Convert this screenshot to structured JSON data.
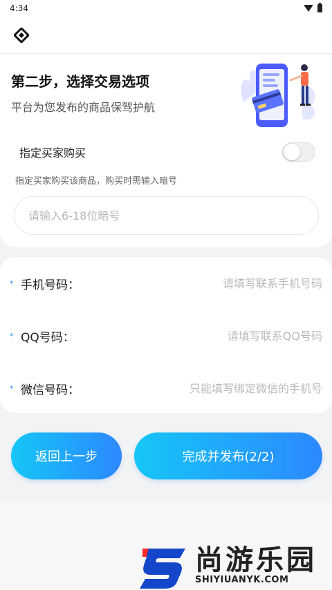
{
  "status": {
    "time": "4:34"
  },
  "colors": {
    "accent": "#2c88ff",
    "accent_light": "#15c6f7",
    "star": "#2e8bff"
  },
  "header": {
    "title": "第二步，选择交易选项",
    "subtitle": "平台为您发布的商品保驾护航"
  },
  "designated_buyer": {
    "label": "指定买家购买",
    "enabled": false,
    "hint": "指定买家购买该商品，购买时需输入暗号",
    "code_placeholder": "请输入6-18位暗号"
  },
  "contact": {
    "phone": {
      "star": "*",
      "label": "手机号码：",
      "placeholder": "请填写联系手机号码"
    },
    "qq": {
      "star": "*",
      "label": "QQ号码：",
      "placeholder": "请填写联系QQ号码"
    },
    "wechat": {
      "star": "*",
      "label": "微信号码：",
      "placeholder": "只能填写绑定微信的手机号"
    }
  },
  "actions": {
    "back_label": "返回上一步",
    "submit_label": "完成并发布(2/2)"
  },
  "watermark": {
    "cn": "尚游乐园",
    "en": "SHIYIUANYK.COM"
  },
  "icons": {
    "logo": "diamond-logo-icon",
    "wifi": "wifi-icon",
    "battery": "battery-icon",
    "illustration": "phone-payment-illustration"
  }
}
